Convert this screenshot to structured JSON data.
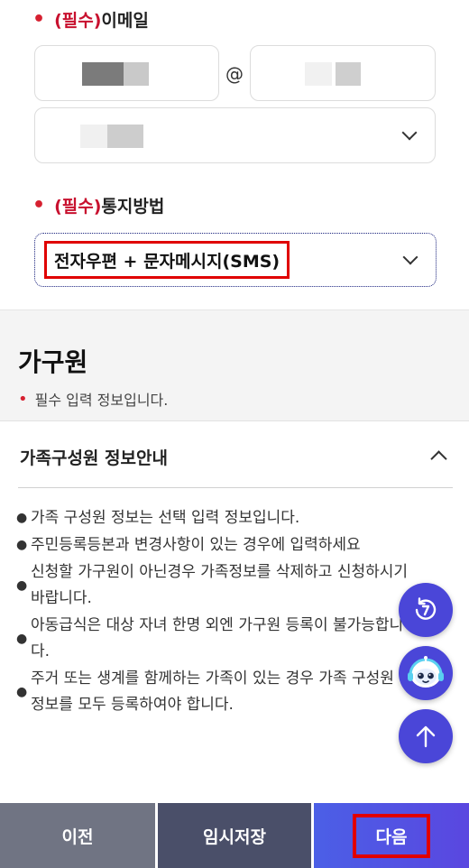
{
  "email": {
    "label_required": "(필수)",
    "label_text": "이메일",
    "at_sign": "@"
  },
  "notify": {
    "label_required": "(필수)",
    "label_text": "통지방법",
    "selected": "전자우편 + 문자메시지(SMS)"
  },
  "household": {
    "title": "가구원",
    "note": "필수 입력 정보입니다."
  },
  "accordion": {
    "title": "가족구성원 정보안내",
    "items": [
      "가족 구성원 정보는 선택 입력 정보입니다.",
      "주민등록등본과 변경사항이 있는 경우에 입력하세요",
      "신청할 가구원이 아닌경우 가족정보를 삭제하고 신청하시기\n바랍니다.",
      "아동급식은 대상 자녀 한명 외엔 가구원 등록이 불가능합니\n다.",
      "주거 또는 생계를 함께하는 가족이 있는 경우 가족 구성원\n정보를 모두 등록하여야 합니다."
    ]
  },
  "buttons": {
    "prev": "이전",
    "save": "임시저장",
    "next": "다음"
  },
  "colors": {
    "required_red": "#c8102e",
    "fab_purple": "#4a46d8",
    "highlight_red": "#e00000"
  }
}
